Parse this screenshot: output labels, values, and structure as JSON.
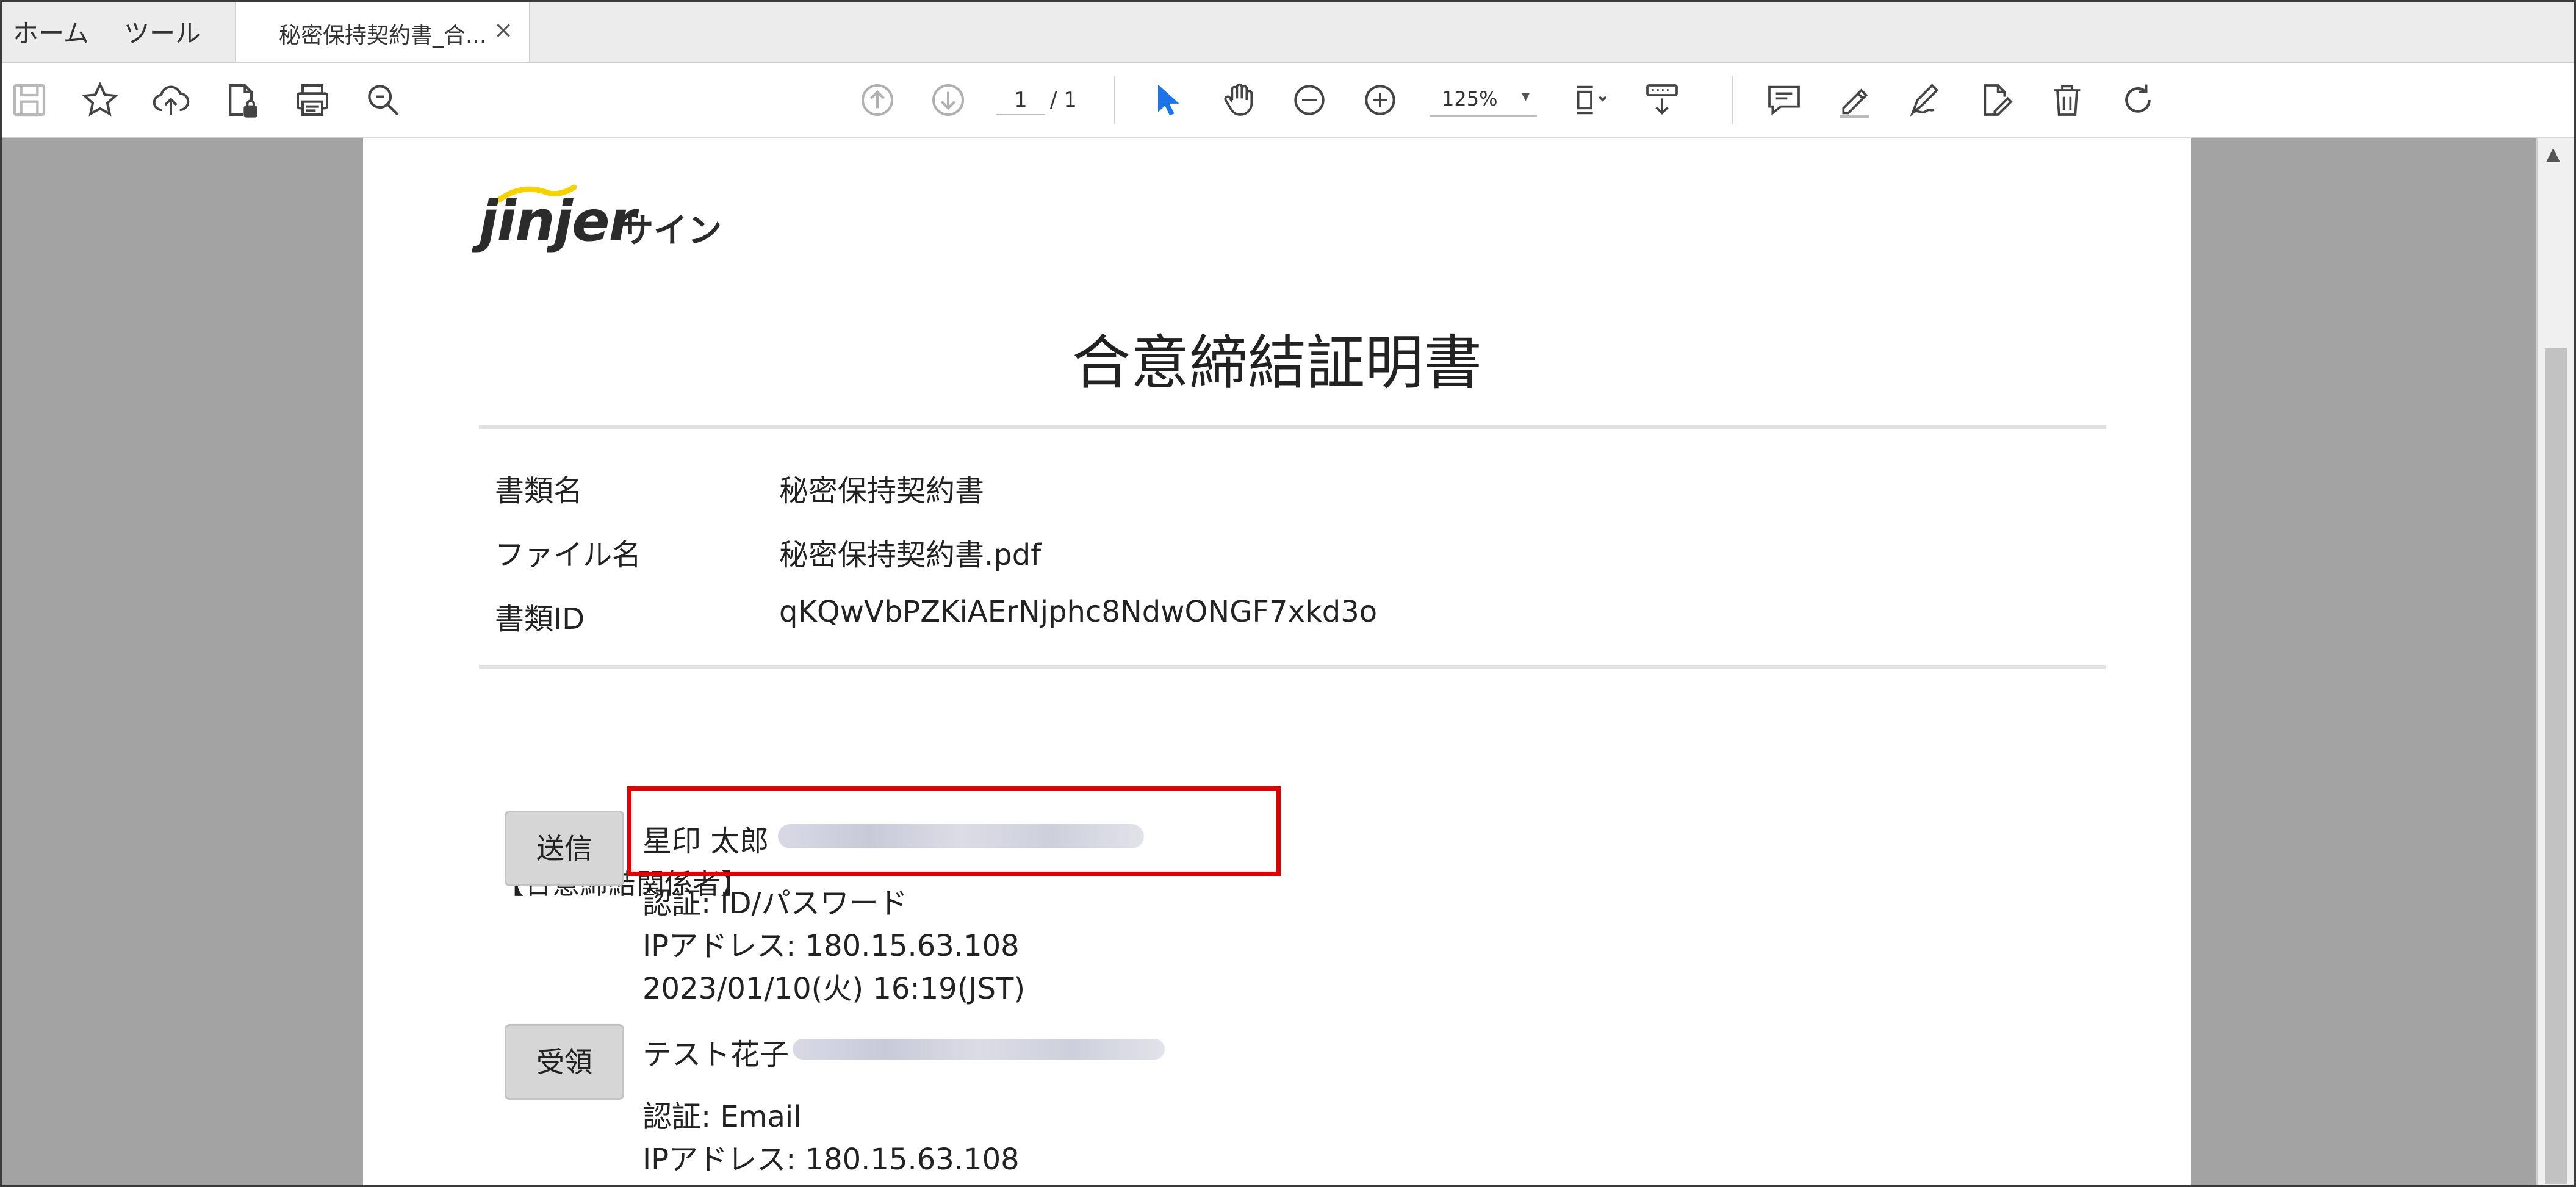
{
  "tabs": {
    "home": "ホーム",
    "tools": "ツール",
    "document_tab": "秘密保持契約書_合...",
    "close": "×"
  },
  "toolbar": {
    "current_page": "1",
    "total_pages": "/ 1",
    "zoom": "125%",
    "zoom_caret": "▾",
    "icons": [
      "save-icon",
      "bookmark-star-icon",
      "upload-cloud-icon",
      "lock-file-icon",
      "print-icon",
      "zoom-search-icon",
      "page-up-icon",
      "page-down-icon",
      "select-cursor-icon",
      "hand-tool-icon",
      "zoom-out-icon",
      "zoom-in-icon",
      "page-fit-icon",
      "scroll-mode-icon",
      "comment-icon",
      "highlight-pen-icon",
      "sign-icon",
      "edit-pdf-icon",
      "trash-icon",
      "rotate-icon"
    ],
    "accent_color": "#1a73e8"
  },
  "document": {
    "logo_word": "jinjer",
    "logo_suffix": "サイン",
    "title": "合意締結証明書",
    "info": [
      {
        "label": "書類名",
        "value": "秘密保持契約書"
      },
      {
        "label": "ファイル名",
        "value": "秘密保持契約書.pdf"
      },
      {
        "label": "書類ID",
        "value": "qKQwVbPZKiAErNjphc8NdwONGF7xkd3o"
      }
    ],
    "section_heading": "【合意締結関係者】",
    "parties": [
      {
        "role": "送信",
        "name": "星印 太郎",
        "auth": "認証: ID/パスワード",
        "ip": "IPアドレス: 180.15.63.108",
        "datetime": "2023/01/10(火) 16:19(JST)"
      },
      {
        "role": "受領",
        "name": "テスト花子",
        "auth": "認証: Email",
        "ip": "IPアドレス: 180.15.63.108"
      }
    ],
    "highlight_color": "#e30000"
  }
}
